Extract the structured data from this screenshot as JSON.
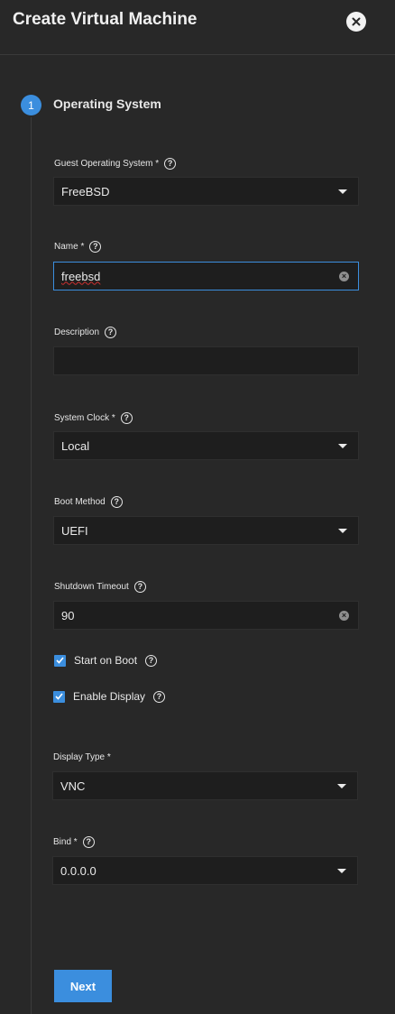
{
  "header": {
    "title": "Create Virtual Machine",
    "close_icon": "close-icon"
  },
  "step": {
    "number": "1",
    "title": "Operating System"
  },
  "fields": {
    "guest_os": {
      "label": "Guest Operating System *",
      "value": "FreeBSD"
    },
    "name": {
      "label": "Name *",
      "value": "freebsd"
    },
    "description": {
      "label": "Description",
      "value": ""
    },
    "system_clock": {
      "label": "System Clock *",
      "value": "Local"
    },
    "boot_method": {
      "label": "Boot Method",
      "value": "UEFI"
    },
    "shutdown_timeout": {
      "label": "Shutdown Timeout",
      "value": "90"
    },
    "start_on_boot": {
      "label": "Start on Boot",
      "checked": true
    },
    "enable_display": {
      "label": "Enable Display",
      "checked": true
    },
    "display_type": {
      "label": "Display Type *",
      "value": "VNC"
    },
    "bind": {
      "label": "Bind *",
      "value": "0.0.0.0"
    }
  },
  "actions": {
    "next_label": "Next"
  },
  "colors": {
    "accent": "#3b8ede",
    "background": "#282828",
    "field_bg": "#1e1e1e"
  }
}
